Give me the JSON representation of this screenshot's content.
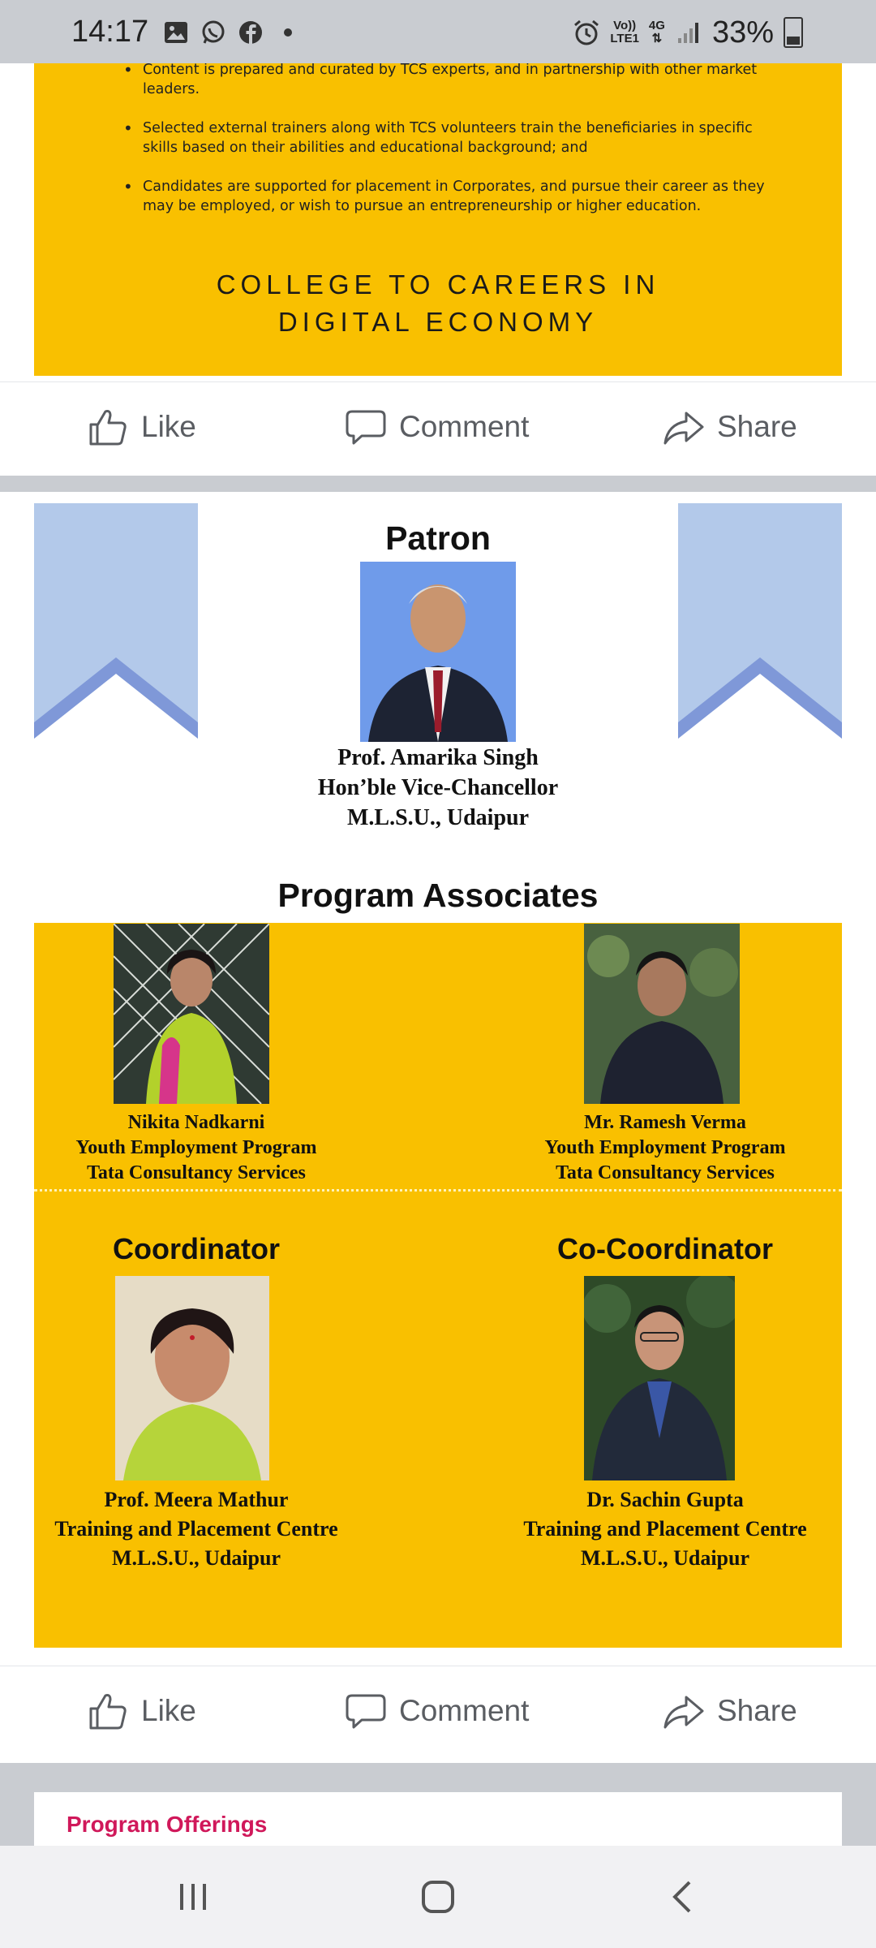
{
  "status_bar": {
    "time": "14:17",
    "network_top": "Vo))",
    "network_bottom": "LTE1",
    "network_type": "4G",
    "battery": "33%",
    "icons": [
      "gallery-icon",
      "whatsapp-icon",
      "facebook-icon",
      "dot-icon",
      "alarm-icon",
      "signal-icon",
      "battery-icon"
    ]
  },
  "post1": {
    "bullets": [
      "Content is prepared and curated by TCS experts, and in partnership with other market leaders.",
      "Selected external trainers along with TCS volunteers train the beneficiaries in specific skills based on their abilities and educational background; and",
      "Candidates are supported for placement in Corporates, and pursue their career as they may be employed, or wish to pursue an entrepreneurship or higher education."
    ],
    "heading_line1": "COLLEGE TO CAREERS IN",
    "heading_line2": "DIGITAL ECONOMY"
  },
  "actions": {
    "like": "Like",
    "comment": "Comment",
    "share": "Share"
  },
  "post2": {
    "patron_title": "Patron",
    "patron": {
      "name": "Prof. Amarika Singh",
      "role": "Hon’ble Vice-Chancellor",
      "org": "M.L.S.U., Udaipur"
    },
    "associates_title": "Program Associates",
    "associates": [
      {
        "name": "Nikita Nadkarni",
        "role": "Youth Employment Program",
        "org": "Tata Consultancy Services"
      },
      {
        "name": "Mr. Ramesh Verma",
        "role": "Youth Employment Program",
        "org": "Tata Consultancy Services"
      }
    ],
    "coordinator_title": "Coordinator",
    "coordinator": {
      "name": "Prof. Meera Mathur",
      "role": "Training and Placement Centre",
      "org": "M.L.S.U., Udaipur"
    },
    "co_coordinator_title": "Co-Coordinator",
    "co_coordinator": {
      "name": "Dr. Sachin Gupta",
      "role": "Training and Placement Centre",
      "org": "M.L.S.U., Udaipur"
    }
  },
  "post3": {
    "title": "Program Offerings"
  },
  "colors": {
    "card_yellow": "#f9c000",
    "ribbon_light": "#b3c9ea",
    "ribbon_dark": "#7f98d8",
    "offerings_pink": "#d0185a"
  }
}
